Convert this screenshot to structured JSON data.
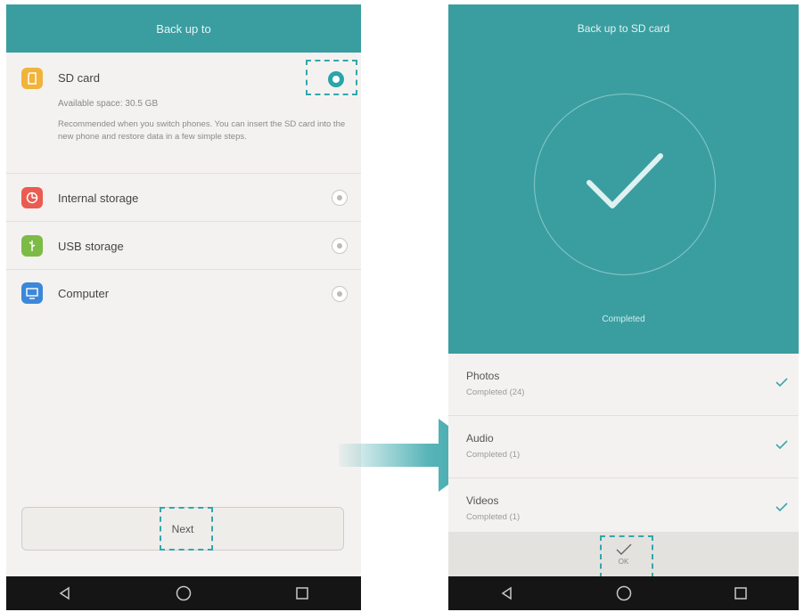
{
  "left": {
    "header_title": "Back up to",
    "options": [
      {
        "title": "SD card",
        "subtitle": "Available space: 30.5 GB",
        "description": "Recommended when you switch phones. You can insert the SD card into the new phone and restore data in a few simple steps.",
        "icon": "sd-card-icon",
        "color": "#f0b33c",
        "selected": true
      },
      {
        "title": "Internal storage",
        "icon": "storage-pie-icon",
        "color": "#ea5b51",
        "selected": false
      },
      {
        "title": "USB storage",
        "icon": "usb-icon",
        "color": "#7cbb45",
        "selected": false
      },
      {
        "title": "Computer",
        "icon": "monitor-icon",
        "color": "#3b88d9",
        "selected": false
      }
    ],
    "next_label": "Next"
  },
  "right": {
    "header_title": "Back up to SD card",
    "status": "Completed",
    "items": [
      {
        "title": "Photos",
        "subtitle": "Completed (24)"
      },
      {
        "title": "Audio",
        "subtitle": "Completed (1)"
      },
      {
        "title": "Videos",
        "subtitle": "Completed (1)"
      }
    ],
    "done_label": "OK"
  },
  "colors": {
    "accent": "#3a9ea0",
    "check": "#3aa7ab"
  }
}
